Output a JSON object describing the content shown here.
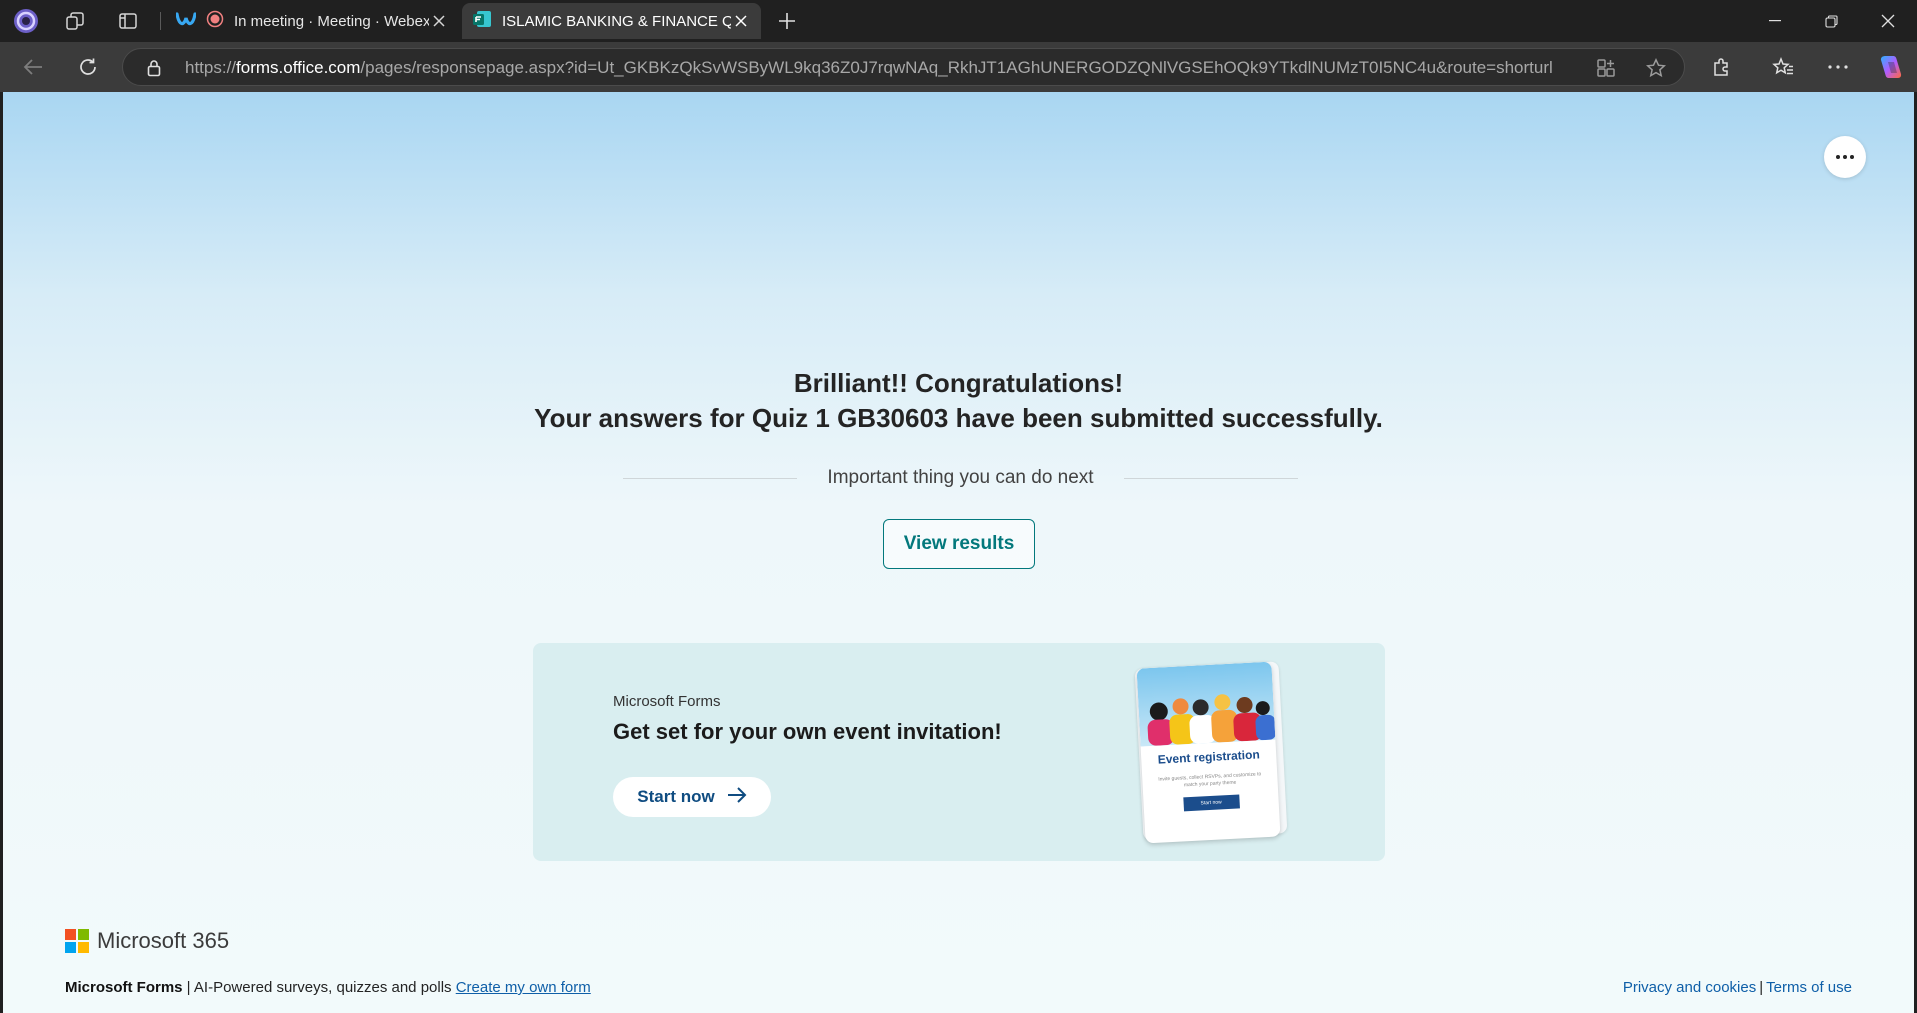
{
  "browser": {
    "tabs": [
      {
        "title": "In meeting · Meeting · Webex",
        "active": false
      },
      {
        "title": "ISLAMIC BANKING & FINANCE Quiz",
        "active": true
      }
    ],
    "url_prefix": "https://",
    "url_domain": "forms.office.com",
    "url_path": "/pages/responsepage.aspx?id=Ut_GKBKzQkSvWSByWL9kq36Z0J7rqwNAq_RkhJT1AGhUNERGODZQNlVGSEhOQk9YTkdlNUMzT0I5NC4u&route=shorturl",
    "icons": [
      "profile-icon",
      "workspaces-icon",
      "tab-actions-icon",
      "webex-icon",
      "recording-icon",
      "forms-icon",
      "new-tab-icon",
      "minimize-icon",
      "restore-icon",
      "close-icon",
      "back-icon",
      "refresh-icon",
      "lock-icon",
      "app-available-icon",
      "favorite-star-icon",
      "extensions-icon",
      "favorites-icon",
      "more-icon",
      "copilot-icon"
    ]
  },
  "page": {
    "headline_line1": "Brilliant!! Congratulations!",
    "headline_line2": "Your answers for Quiz 1 GB30603 have been submitted successfully.",
    "next_label": "Important thing you can do next",
    "view_results": "View results",
    "promo": {
      "brand": "Microsoft Forms",
      "title": "Get set for your own event invitation!",
      "start": "Start now",
      "card_title": "Event registration",
      "card_text": "Invite guests, collect RSVPs, and customize to match your party theme",
      "card_button": "Start now"
    },
    "logo_text": "Microsoft 365",
    "footer": {
      "brand": "Microsoft Forms",
      "tagline": " | AI-Powered surveys, quizzes and polls ",
      "create_link": "Create my own form",
      "privacy": "Privacy and cookies",
      "separator": "|",
      "terms": "Terms of use"
    }
  },
  "colors": {
    "accent": "#03787c",
    "link": "#0f5fa8",
    "chrome_bg": "#202020"
  }
}
